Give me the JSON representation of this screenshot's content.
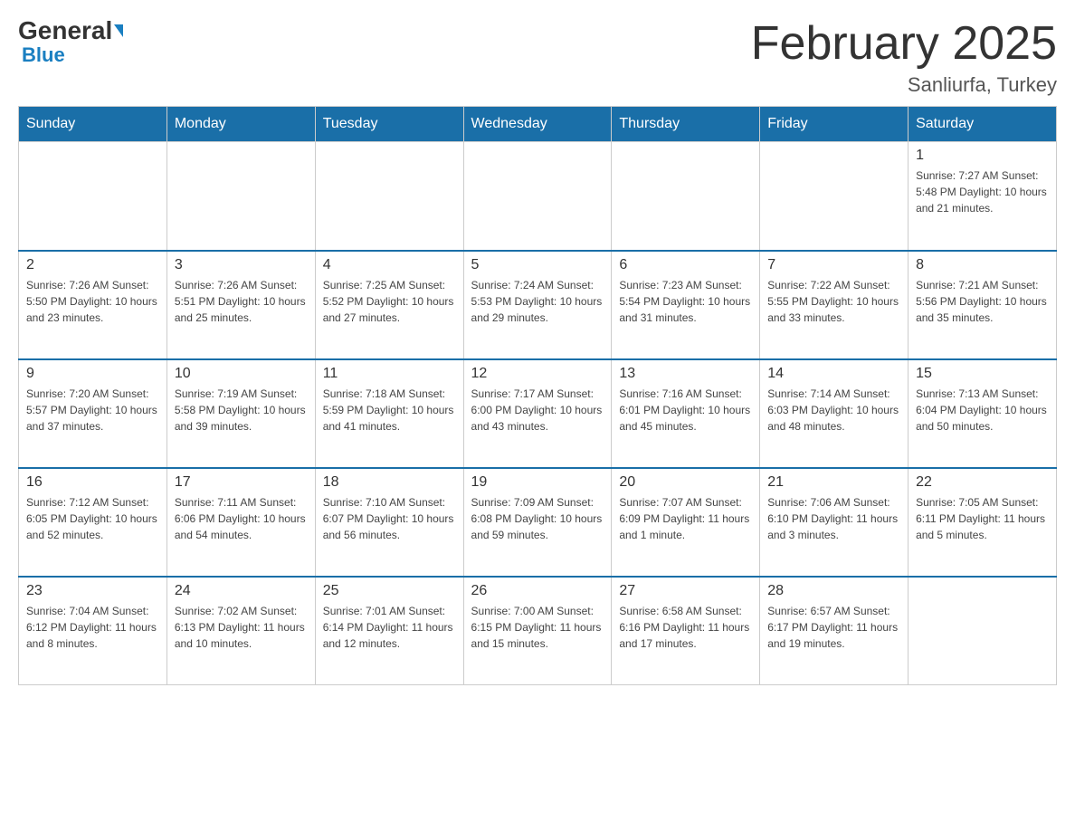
{
  "header": {
    "logo_general": "General",
    "logo_blue": "Blue",
    "title": "February 2025",
    "location": "Sanliurfa, Turkey"
  },
  "days_of_week": [
    "Sunday",
    "Monday",
    "Tuesday",
    "Wednesday",
    "Thursday",
    "Friday",
    "Saturday"
  ],
  "weeks": [
    [
      {
        "day": "",
        "info": ""
      },
      {
        "day": "",
        "info": ""
      },
      {
        "day": "",
        "info": ""
      },
      {
        "day": "",
        "info": ""
      },
      {
        "day": "",
        "info": ""
      },
      {
        "day": "",
        "info": ""
      },
      {
        "day": "1",
        "info": "Sunrise: 7:27 AM\nSunset: 5:48 PM\nDaylight: 10 hours and 21 minutes."
      }
    ],
    [
      {
        "day": "2",
        "info": "Sunrise: 7:26 AM\nSunset: 5:50 PM\nDaylight: 10 hours and 23 minutes."
      },
      {
        "day": "3",
        "info": "Sunrise: 7:26 AM\nSunset: 5:51 PM\nDaylight: 10 hours and 25 minutes."
      },
      {
        "day": "4",
        "info": "Sunrise: 7:25 AM\nSunset: 5:52 PM\nDaylight: 10 hours and 27 minutes."
      },
      {
        "day": "5",
        "info": "Sunrise: 7:24 AM\nSunset: 5:53 PM\nDaylight: 10 hours and 29 minutes."
      },
      {
        "day": "6",
        "info": "Sunrise: 7:23 AM\nSunset: 5:54 PM\nDaylight: 10 hours and 31 minutes."
      },
      {
        "day": "7",
        "info": "Sunrise: 7:22 AM\nSunset: 5:55 PM\nDaylight: 10 hours and 33 minutes."
      },
      {
        "day": "8",
        "info": "Sunrise: 7:21 AM\nSunset: 5:56 PM\nDaylight: 10 hours and 35 minutes."
      }
    ],
    [
      {
        "day": "9",
        "info": "Sunrise: 7:20 AM\nSunset: 5:57 PM\nDaylight: 10 hours and 37 minutes."
      },
      {
        "day": "10",
        "info": "Sunrise: 7:19 AM\nSunset: 5:58 PM\nDaylight: 10 hours and 39 minutes."
      },
      {
        "day": "11",
        "info": "Sunrise: 7:18 AM\nSunset: 5:59 PM\nDaylight: 10 hours and 41 minutes."
      },
      {
        "day": "12",
        "info": "Sunrise: 7:17 AM\nSunset: 6:00 PM\nDaylight: 10 hours and 43 minutes."
      },
      {
        "day": "13",
        "info": "Sunrise: 7:16 AM\nSunset: 6:01 PM\nDaylight: 10 hours and 45 minutes."
      },
      {
        "day": "14",
        "info": "Sunrise: 7:14 AM\nSunset: 6:03 PM\nDaylight: 10 hours and 48 minutes."
      },
      {
        "day": "15",
        "info": "Sunrise: 7:13 AM\nSunset: 6:04 PM\nDaylight: 10 hours and 50 minutes."
      }
    ],
    [
      {
        "day": "16",
        "info": "Sunrise: 7:12 AM\nSunset: 6:05 PM\nDaylight: 10 hours and 52 minutes."
      },
      {
        "day": "17",
        "info": "Sunrise: 7:11 AM\nSunset: 6:06 PM\nDaylight: 10 hours and 54 minutes."
      },
      {
        "day": "18",
        "info": "Sunrise: 7:10 AM\nSunset: 6:07 PM\nDaylight: 10 hours and 56 minutes."
      },
      {
        "day": "19",
        "info": "Sunrise: 7:09 AM\nSunset: 6:08 PM\nDaylight: 10 hours and 59 minutes."
      },
      {
        "day": "20",
        "info": "Sunrise: 7:07 AM\nSunset: 6:09 PM\nDaylight: 11 hours and 1 minute."
      },
      {
        "day": "21",
        "info": "Sunrise: 7:06 AM\nSunset: 6:10 PM\nDaylight: 11 hours and 3 minutes."
      },
      {
        "day": "22",
        "info": "Sunrise: 7:05 AM\nSunset: 6:11 PM\nDaylight: 11 hours and 5 minutes."
      }
    ],
    [
      {
        "day": "23",
        "info": "Sunrise: 7:04 AM\nSunset: 6:12 PM\nDaylight: 11 hours and 8 minutes."
      },
      {
        "day": "24",
        "info": "Sunrise: 7:02 AM\nSunset: 6:13 PM\nDaylight: 11 hours and 10 minutes."
      },
      {
        "day": "25",
        "info": "Sunrise: 7:01 AM\nSunset: 6:14 PM\nDaylight: 11 hours and 12 minutes."
      },
      {
        "day": "26",
        "info": "Sunrise: 7:00 AM\nSunset: 6:15 PM\nDaylight: 11 hours and 15 minutes."
      },
      {
        "day": "27",
        "info": "Sunrise: 6:58 AM\nSunset: 6:16 PM\nDaylight: 11 hours and 17 minutes."
      },
      {
        "day": "28",
        "info": "Sunrise: 6:57 AM\nSunset: 6:17 PM\nDaylight: 11 hours and 19 minutes."
      },
      {
        "day": "",
        "info": ""
      }
    ]
  ]
}
